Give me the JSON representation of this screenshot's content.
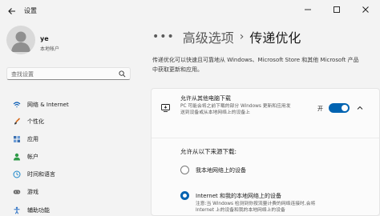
{
  "app": {
    "title": "设置"
  },
  "user": {
    "name": "ye",
    "account_type": "本地帐户"
  },
  "search": {
    "placeholder": "查找设置"
  },
  "sidebar": {
    "items": [
      {
        "label": "网络 & Internet",
        "icon": "wifi-icon",
        "color": "#0a5db5"
      },
      {
        "label": "个性化",
        "icon": "brush-icon",
        "color": "#d46b1d"
      },
      {
        "label": "应用",
        "icon": "apps-icon",
        "color": "#3a6fb0"
      },
      {
        "label": "帐户",
        "icon": "person-icon",
        "color": "#2f9a48"
      },
      {
        "label": "时间和语言",
        "icon": "globe-clock-icon",
        "color": "#1a86c9"
      },
      {
        "label": "游戏",
        "icon": "gamepad-icon",
        "color": "#6b6b6b"
      },
      {
        "label": "辅助功能",
        "icon": "accessibility-icon",
        "color": "#2a70c4"
      }
    ]
  },
  "breadcrumb": {
    "dots": "•••",
    "parent": "高级选项",
    "separator": "›",
    "current": "传递优化"
  },
  "description": "传递优化可以快速且可靠地从 Windows、Microsoft Store 和其他 Microsoft 产品中获取更新和应用。",
  "card": {
    "title": "允许从其他电脑下载",
    "desc": "PC 可能会将之前下载的部分 Windows 更新和应用发送到设备或从本地网络上的设备上",
    "toggle_label": "开",
    "toggle_on": true,
    "section_label": "允许从以下来源下载:",
    "options": [
      {
        "label": "我本地网络上的设备",
        "desc": "",
        "checked": false
      },
      {
        "label": "Internet 和我的本地网络上的设备",
        "desc": "注意:当 Windows 检测到你按流量计费的网络连接时,会将 Internet 上的设备和我的本地网络上的设备",
        "checked": true
      }
    ]
  },
  "colors": {
    "accent": "#0063b1",
    "background": "#f3f3f3",
    "card": "#fbfbfb"
  }
}
